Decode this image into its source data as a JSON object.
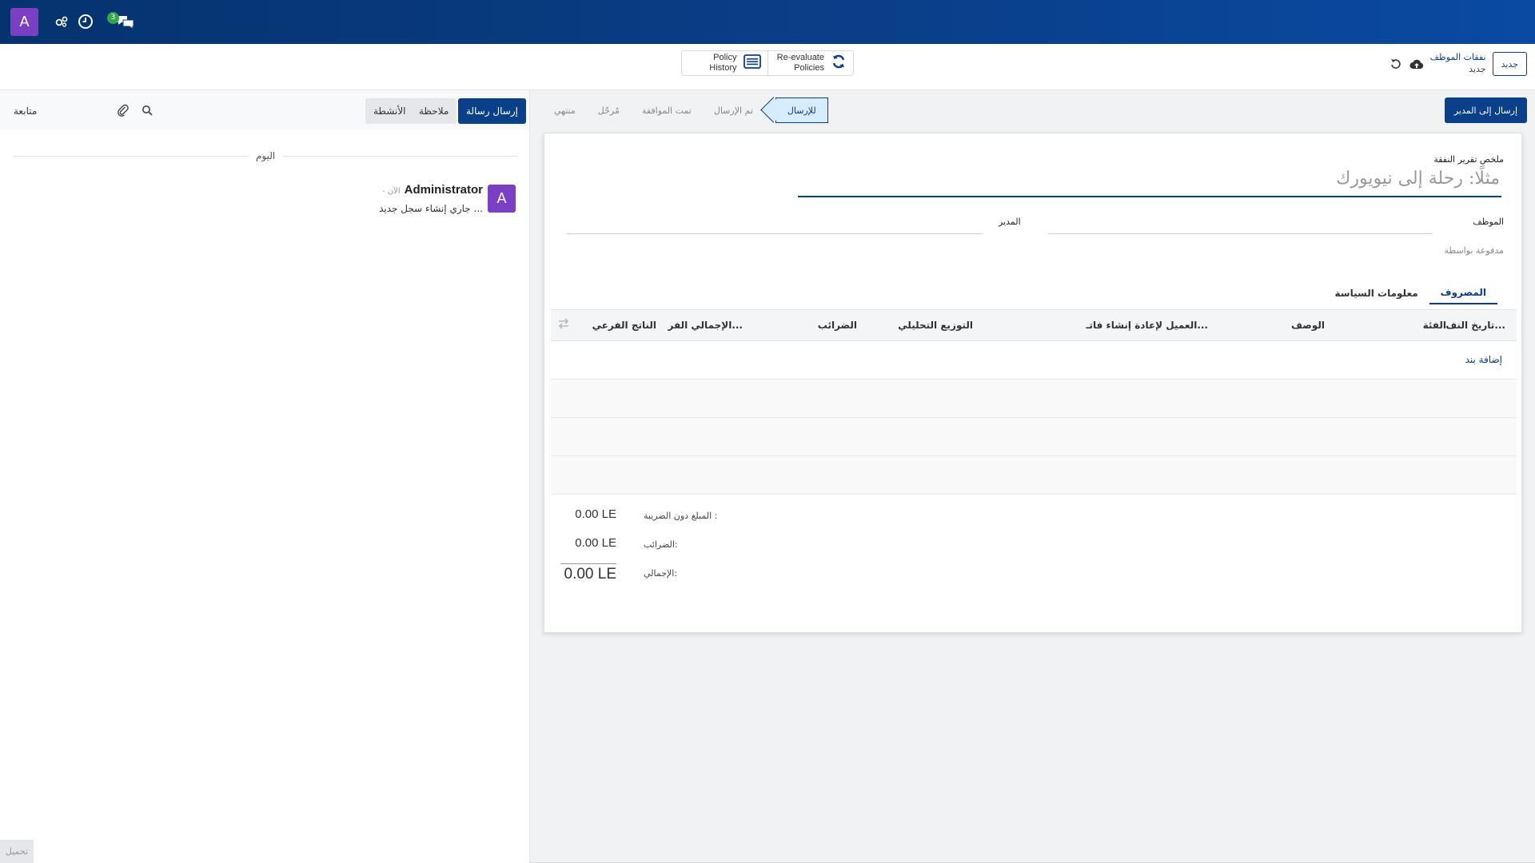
{
  "topbar": {
    "avatar_letter": "A",
    "chat_badge": "3"
  },
  "controlbar": {
    "new_button": "جديد",
    "breadcrumb_parent": "نفقات الموظف",
    "breadcrumb_current": "جديد",
    "policy_history_line1": "Policy",
    "policy_history_line2": "History",
    "reevaluate_line1": "Re-evaluate",
    "reevaluate_line2": "Policies"
  },
  "status": {
    "send_to_manager": "إرسال إلى المدير",
    "steps": [
      "للإرسال",
      "تم الإرسال",
      "تمت الموافقة",
      "مُرحّل",
      "منتهي"
    ],
    "active_index": 0
  },
  "form": {
    "summary_label": "ملخص تقرير النفقة",
    "summary_placeholder": "مثلًا: رحلة إلى نيويورك",
    "employee_label": "الموظف",
    "manager_label": "المدير",
    "paid_by_label": "مدفوعة بواسطة",
    "tabs": [
      "المصروف",
      "معلومات السياسة"
    ],
    "active_tab": 0,
    "columns": [
      "تاريخ النف...",
      "الفئة",
      "الوصف",
      "العميل لإعادة إنشاء فاتـ...",
      "التوزيع التحليلي",
      "الضرائب",
      "الإجمالي الفر...",
      "الناتج الفرعي"
    ],
    "add_line": "إضافة بند",
    "totals": {
      "untaxed_label": "المبلغ دون الضريبة :",
      "untaxed_value": "0.00 LE",
      "taxes_label": "الضرائب:",
      "taxes_value": "0.00 LE",
      "total_label": "الإجمالي:",
      "total_value": "0.00 LE"
    }
  },
  "chatter": {
    "send_message": "إرسال رسالة",
    "log_note": "ملاحظة",
    "activities": "الأنشطة",
    "follow": "متابعة",
    "day_label": "اليوم",
    "message": {
      "avatar_letter": "A",
      "author": "Administrator",
      "time": "- الآن",
      "body": "جاري إنشاء سجل جديد ..."
    },
    "loading": "تحميل"
  },
  "colors": {
    "brand": "#0a3f8a",
    "avatar": "#7b3fc4",
    "badge": "#2fa74a",
    "status_active_bg": "#d7ecff"
  }
}
